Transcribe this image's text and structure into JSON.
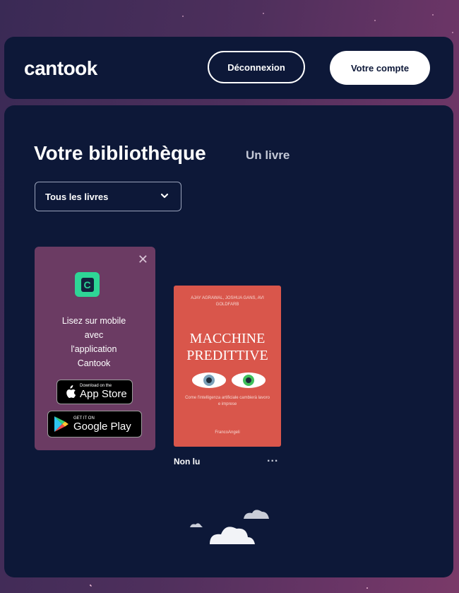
{
  "header": {
    "logo": "cantook",
    "logout_label": "Déconnexion",
    "account_label": "Votre compte"
  },
  "library": {
    "title": "Votre bibliothèque",
    "count": "Un livre",
    "filter": {
      "selected": "Tous les livres"
    }
  },
  "promo": {
    "app_icon_letter": "C",
    "text_lines": [
      "Lisez sur mobile",
      "avec",
      "l'application",
      "Cantook"
    ],
    "app_store": {
      "small": "Download on the",
      "big": "App Store"
    },
    "google_play": {
      "small": "GET IT ON",
      "big": "Google Play"
    }
  },
  "books": [
    {
      "cover": {
        "authors": "AJAY AGRAWAL, JOSHUA GANS, AVI GOLDFARB",
        "title_line1": "MACCHINE",
        "title_line2": "PREDITTIVE",
        "subtitle": "Come l'intelligenza artificiale cambierà lavoro e imprese",
        "publisher": "FrancoAngeli"
      },
      "status": "Non lu",
      "more_label": "..."
    }
  ],
  "colors": {
    "background": "#4e2f5c",
    "panel": "#0d1838",
    "promo": "#6b3b63",
    "accent": "#2ed596",
    "book_cover": "#d9564b"
  },
  "icons": {
    "close": "close-icon",
    "chevron": "chevron-down-icon",
    "apple": "apple-icon",
    "google_play": "google-play-icon",
    "clouds": "clouds-illustration"
  }
}
